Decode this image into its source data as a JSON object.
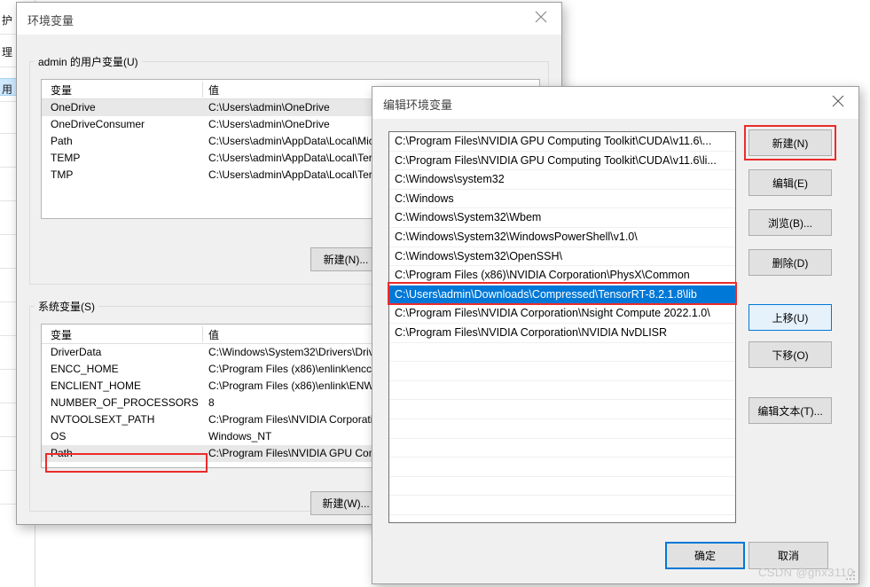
{
  "background_window": {
    "fragments": [
      "护",
      "理",
      "用"
    ]
  },
  "env_dialog": {
    "title": "环境变量",
    "close_icon": "close-icon",
    "user_group_label": "admin 的用户变量(U)",
    "system_group_label": "系统变量(S)",
    "columns": [
      "变量",
      "值"
    ],
    "user_variables": [
      {
        "name": "OneDrive",
        "value": "C:\\Users\\admin\\OneDrive"
      },
      {
        "name": "OneDriveConsumer",
        "value": "C:\\Users\\admin\\OneDrive"
      },
      {
        "name": "Path",
        "value": "C:\\Users\\admin\\AppData\\Local\\Mic"
      },
      {
        "name": "TEMP",
        "value": "C:\\Users\\admin\\AppData\\Local\\Ter"
      },
      {
        "name": "TMP",
        "value": "C:\\Users\\admin\\AppData\\Local\\Ter"
      }
    ],
    "system_variables": [
      {
        "name": "DriverData",
        "value": "C:\\Windows\\System32\\Drivers\\Driv"
      },
      {
        "name": "ENCC_HOME",
        "value": "C:\\Program Files (x86)\\enlink\\encc\\"
      },
      {
        "name": "ENCLIENT_HOME",
        "value": "C:\\Program Files (x86)\\enlink\\ENWA"
      },
      {
        "name": "NUMBER_OF_PROCESSORS",
        "value": "8"
      },
      {
        "name": "NVTOOLSEXT_PATH",
        "value": "C:\\Program Files\\NVIDIA Corporati"
      },
      {
        "name": "OS",
        "value": "Windows_NT"
      },
      {
        "name": "Path",
        "value": "C:\\Program Files\\NVIDIA GPU Com"
      }
    ],
    "user_new_button": "新建(N)...",
    "system_new_button": "新建(W)..."
  },
  "edit_dialog": {
    "title": "编辑环境变量",
    "close_icon": "close-icon",
    "path_entries": [
      "C:\\Program Files\\NVIDIA GPU Computing Toolkit\\CUDA\\v11.6\\...",
      "C:\\Program Files\\NVIDIA GPU Computing Toolkit\\CUDA\\v11.6\\li...",
      "C:\\Windows\\system32",
      "C:\\Windows",
      "C:\\Windows\\System32\\Wbem",
      "C:\\Windows\\System32\\WindowsPowerShell\\v1.0\\",
      "C:\\Windows\\System32\\OpenSSH\\",
      "C:\\Program Files (x86)\\NVIDIA Corporation\\PhysX\\Common",
      "C:\\Users\\admin\\Downloads\\Compressed\\TensorRT-8.2.1.8\\lib",
      "C:\\Program Files\\NVIDIA Corporation\\Nsight Compute 2022.1.0\\",
      "C:\\Program Files\\NVIDIA Corporation\\NVIDIA NvDLISR"
    ],
    "selected_index": 8,
    "side_buttons": [
      "新建(N)",
      "编辑(E)",
      "浏览(B)...",
      "删除(D)",
      "上移(U)",
      "下移(O)",
      "编辑文本(T)..."
    ],
    "ok_button": "确定",
    "cancel_button": "取消"
  },
  "watermark": "CSDN @ghx3110",
  "colors": {
    "selection_blue": "#0078d7",
    "annotation_red": "#ec2b2b",
    "dialog_face": "#f0f0f0",
    "button_face": "#e1e1e1"
  }
}
